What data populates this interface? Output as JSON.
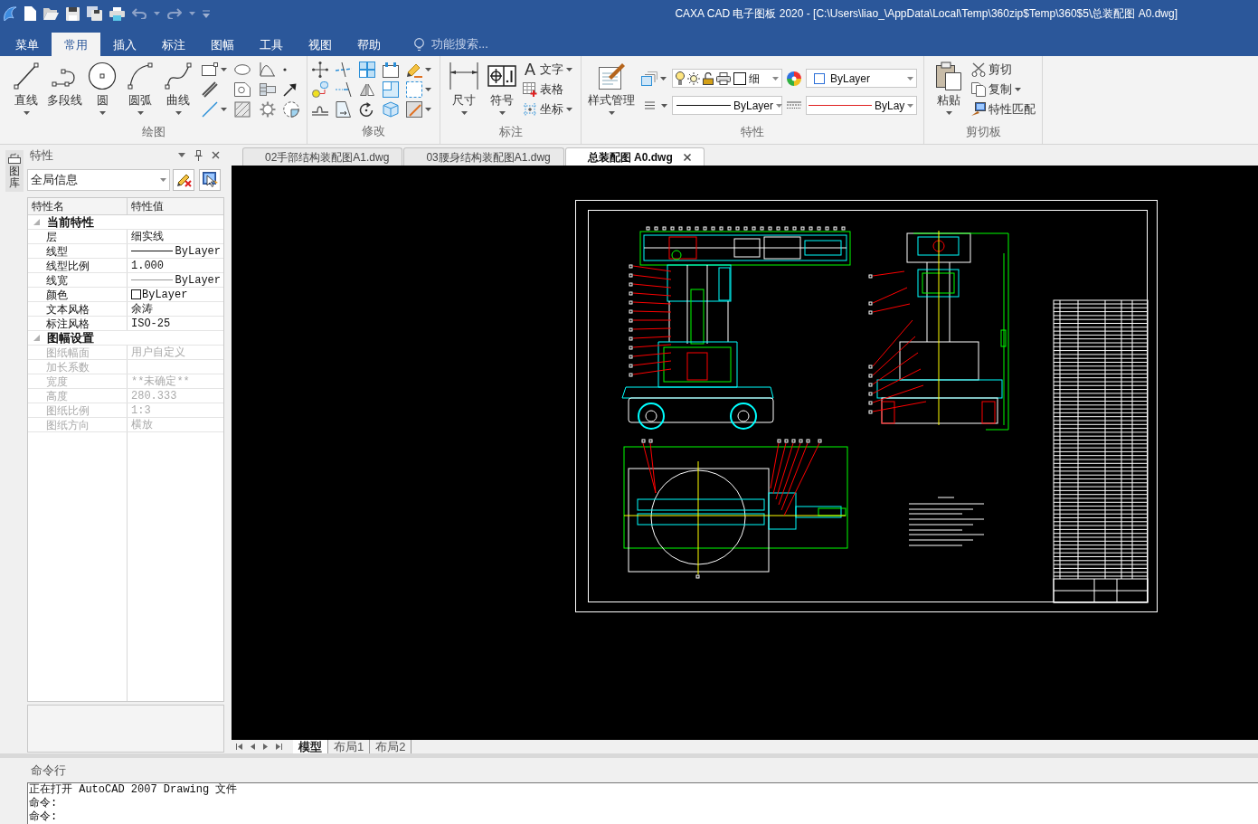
{
  "title_bar": {
    "title": "CAXA CAD 电子图板 2020 - [C:\\Users\\liao_\\AppData\\Local\\Temp\\360zip$Temp\\360$5\\总装配图 A0.dwg]"
  },
  "ribbon_tabs": [
    {
      "label": "菜单",
      "selected": false
    },
    {
      "label": "常用",
      "selected": true
    },
    {
      "label": "插入",
      "selected": false
    },
    {
      "label": "标注",
      "selected": false
    },
    {
      "label": "图幅",
      "selected": false
    },
    {
      "label": "工具",
      "selected": false
    },
    {
      "label": "视图",
      "selected": false
    },
    {
      "label": "帮助",
      "selected": false
    }
  ],
  "search": {
    "placeholder": "功能搜索..."
  },
  "ribbon_groups": [
    {
      "kind": "draw",
      "title": "绘图",
      "buttons": [
        {
          "label": "直线",
          "dropdown": true
        },
        {
          "label": "多段线",
          "dropdown": false
        },
        {
          "label": "圆",
          "dropdown": true
        },
        {
          "label": "圆弧",
          "dropdown": true
        },
        {
          "label": "曲线",
          "dropdown": true
        }
      ]
    },
    {
      "kind": "modify",
      "title": "修改"
    },
    {
      "kind": "annotate",
      "title": "标注",
      "buttons": [
        {
          "label": "尺寸",
          "dropdown": true
        },
        {
          "label": "符号",
          "dropdown": true
        }
      ],
      "small_buttons": [
        {
          "label": "文字",
          "glyph": "A",
          "dropdown": true
        },
        {
          "label": "表格",
          "dropdown": false
        },
        {
          "label": "坐标",
          "dropdown": true
        }
      ]
    },
    {
      "kind": "properties",
      "title": "特性",
      "buttons": [
        {
          "label": "样式管理",
          "dropdown": true
        }
      ],
      "layer": {
        "value": "细"
      },
      "color": {
        "value": "ByLayer"
      },
      "linetype": {
        "value": "ByLayer"
      },
      "lineweight": {
        "value": "ByLay"
      }
    },
    {
      "kind": "clipboard",
      "title": "剪切板",
      "buttons": [
        {
          "label": "粘贴",
          "dropdown": true
        }
      ],
      "small_buttons": [
        {
          "label": "剪切",
          "dropdown": false
        },
        {
          "label": "复制",
          "dropdown": true
        },
        {
          "label": "特性匹配",
          "dropdown": false
        }
      ]
    }
  ],
  "side_tab": {
    "label": "图库"
  },
  "properties_panel": {
    "title": "特性",
    "selector": {
      "value": "全局信息"
    },
    "columns": [
      "特性名",
      "特性值"
    ],
    "sections": [
      {
        "title": "当前特性",
        "expanded": true,
        "rows": [
          {
            "name": "层",
            "kind": "text",
            "value": "细实线",
            "disabled": false
          },
          {
            "name": "线型",
            "kind": "linetype",
            "value": "ByLayer",
            "disabled": false
          },
          {
            "name": "线型比例",
            "kind": "text",
            "value": "1.000",
            "disabled": false
          },
          {
            "name": "线宽",
            "kind": "lineweight",
            "value": "ByLayer",
            "disabled": false
          },
          {
            "name": "颜色",
            "kind": "color",
            "value": "ByLayer",
            "disabled": false
          },
          {
            "name": "文本风格",
            "kind": "text",
            "value": "余涛",
            "disabled": false
          },
          {
            "name": "标注风格",
            "kind": "text",
            "value": "ISO-25",
            "disabled": false
          }
        ]
      },
      {
        "title": "图幅设置",
        "expanded": true,
        "rows": [
          {
            "name": "图纸幅面",
            "kind": "text",
            "value": "用户自定义",
            "disabled": true
          },
          {
            "name": "加长系数",
            "kind": "text",
            "disabled": true
          },
          {
            "name": "宽度",
            "kind": "text",
            "value": "**未确定**",
            "disabled": true
          },
          {
            "name": "高度",
            "kind": "text",
            "value": "280.333",
            "disabled": true
          },
          {
            "name": "图纸比例",
            "kind": "text",
            "value": "1:3",
            "disabled": true
          },
          {
            "name": "图纸方向",
            "kind": "text",
            "value": "横放",
            "disabled": true
          }
        ]
      }
    ]
  },
  "document_tabs": [
    {
      "label": "02手部结构装配图A1.dwg",
      "selected": false
    },
    {
      "label": "03腰身结构装配图A1.dwg",
      "selected": false
    },
    {
      "label": "总装配图 A0.dwg",
      "selected": true
    }
  ],
  "layout_tabs": [
    {
      "label": "模型",
      "selected": true
    },
    {
      "label": "布局1",
      "selected": false
    },
    {
      "label": "布局2",
      "selected": false
    }
  ],
  "command_line": {
    "title": "命令行",
    "lines": [
      "正在打开 AutoCAD 2007 Drawing 文件",
      "命令:",
      "命令:"
    ]
  }
}
